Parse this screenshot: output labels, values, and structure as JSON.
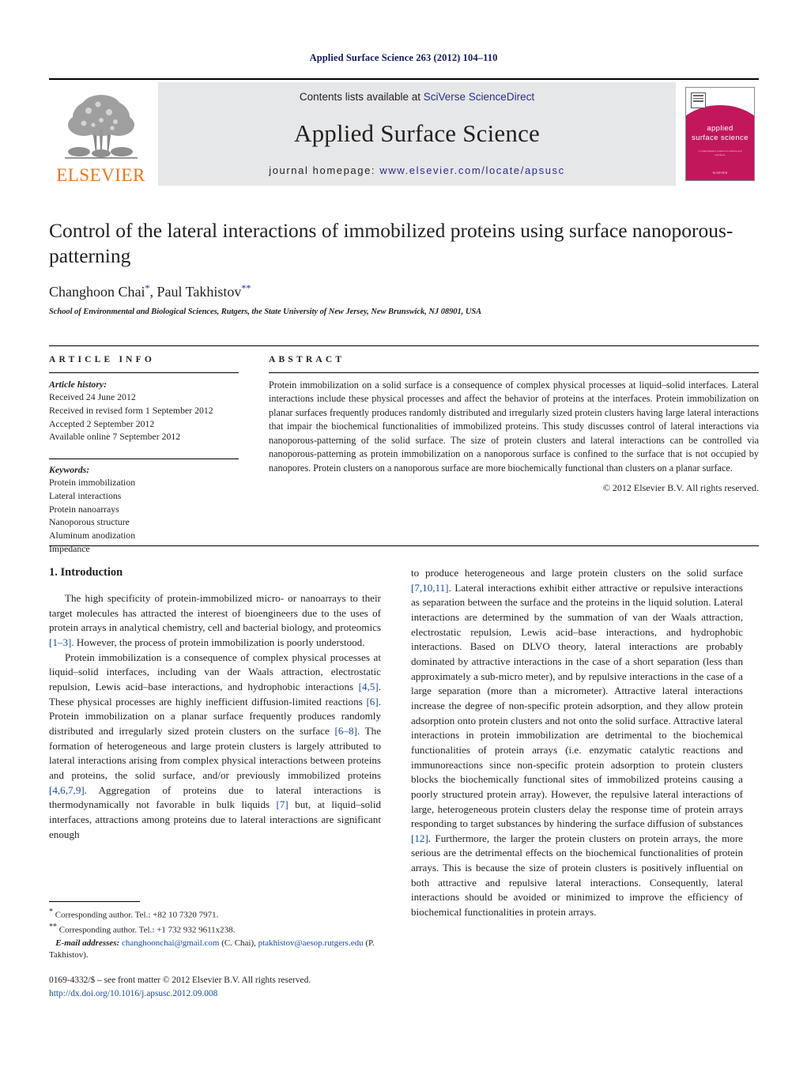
{
  "running_head": "Applied Surface Science 263 (2012) 104–110",
  "masthead": {
    "publisher_logo_text": "ELSEVIER",
    "contents_prefix": "Contents lists available at ",
    "contents_link": "SciVerse ScienceDirect",
    "journal_name": "Applied Surface Science",
    "homepage_prefix": "journal homepage: ",
    "homepage_url": "www.elsevier.com/locate/apsusc",
    "cover": {
      "title_line1": "applied",
      "title_line2": "surface science",
      "subtitle": "a comprehensive journal\non surfaces and interfaces",
      "footer": "ELSEVIER"
    },
    "band_bg": "#e6e7e8",
    "link_color": "#2b2b8f",
    "cover_color": "#c2175b",
    "elsevier_orange": "#e87722"
  },
  "title": "Control of the lateral interactions of immobilized proteins using surface nanoporous-patterning",
  "authors": {
    "author1": "Changhoon Chai",
    "author1_mark": "*",
    "separator": ", ",
    "author2": "Paul Takhistov",
    "author2_mark": "**"
  },
  "affiliation": "School of Environmental and Biological Sciences, Rutgers, the State University of New Jersey, New Brunswick, NJ 08901, USA",
  "article_info": {
    "heading": "ARTICLE INFO",
    "history_heading": "Article history:",
    "history": [
      "Received 24 June 2012",
      "Received in revised form 1 September 2012",
      "Accepted 2 September 2012",
      "Available online 7 September 2012"
    ],
    "keywords_heading": "Keywords:",
    "keywords": [
      "Protein immobilization",
      "Lateral interactions",
      "Protein nanoarrays",
      "Nanoporous structure",
      "Aluminum anodization",
      "Impedance"
    ]
  },
  "abstract": {
    "heading": "ABSTRACT",
    "text": "Protein immobilization on a solid surface is a consequence of complex physical processes at liquid–solid interfaces. Lateral interactions include these physical processes and affect the behavior of proteins at the interfaces. Protein immobilization on planar surfaces frequently produces randomly distributed and irregularly sized protein clusters having large lateral interactions that impair the biochemical functionalities of immobilized proteins. This study discusses control of lateral interactions via nanoporous-patterning of the solid surface. The size of protein clusters and lateral interactions can be controlled via nanoporous-patterning as protein immobilization on a nanoporous surface is confined to the surface that is not occupied by nanopores. Protein clusters on a nanoporous surface are more biochemically functional than clusters on a planar surface.",
    "copyright": "© 2012 Elsevier B.V. All rights reserved."
  },
  "body": {
    "section_title": "1.  Introduction",
    "left_paragraphs": [
      "The high specificity of protein-immobilized micro- or nanoarrays to their target molecules has attracted the interest of bioengineers due to the uses of protein arrays in analytical chemistry, cell and bacterial biology, and proteomics [1–3]. However, the process of protein immobilization is poorly understood.",
      "Protein immobilization is a consequence of complex physical processes at liquid–solid interfaces, including van der Waals attraction, electrostatic repulsion, Lewis acid–base interactions, and hydrophobic interactions [4,5]. These physical processes are highly inefficient diffusion-limited reactions [6]. Protein immobilization on a planar surface frequently produces randomly distributed and irregularly sized protein clusters on the surface [6–8]. The formation of heterogeneous and large protein clusters is largely attributed to lateral interactions arising from complex physical interactions between proteins and proteins, the solid surface, and/or previously immobilized proteins [4,6,7,9]. Aggregation of proteins due to lateral interactions is thermodynamically not favorable in bulk liquids [7] but, at liquid–solid interfaces, attractions among proteins due to lateral interactions are significant enough"
    ],
    "right_paragraphs": [
      "to produce heterogeneous and large protein clusters on the solid surface [7,10,11]. Lateral interactions exhibit either attractive or repulsive interactions as separation between the surface and the proteins in the liquid solution. Lateral interactions are determined by the summation of van der Waals attraction, electrostatic repulsion, Lewis acid–base interactions, and hydrophobic interactions. Based on DLVO theory, lateral interactions are probably dominated by attractive interactions in the case of a short separation (less than approximately a sub-micro meter), and by repulsive interactions in the case of a large separation (more than a micrometer). Attractive lateral interactions increase the degree of non-specific protein adsorption, and they allow protein adsorption onto protein clusters and not onto the solid surface. Attractive lateral interactions in protein immobilization are detrimental to the biochemical functionalities of protein arrays (i.e. enzymatic catalytic reactions and immunoreactions since non-specific protein adsorption to protein clusters blocks the biochemically functional sites of immobilized proteins causing a poorly structured protein array). However, the repulsive lateral interactions of large, heterogeneous protein clusters delay the response time of protein arrays responding to target substances by hindering the surface diffusion of substances [12]. Furthermore, the larger the protein clusters on protein arrays, the more serious are the detrimental effects on the biochemical functionalities of protein arrays. This is because the size of protein clusters is positively influential on both attractive and repulsive lateral interactions. Consequently, lateral interactions should be avoided or minimized to improve the efficiency of biochemical functionalities in protein arrays."
    ]
  },
  "footnotes": {
    "line1_mark": "*",
    "line1": "Corresponding author. Tel.: +82 10 7320 7971.",
    "line2_mark": "**",
    "line2": "Corresponding author. Tel.: +1 732 932 9611x238.",
    "email_label": "E-mail addresses:",
    "email1": "changhoonchai@gmail.com",
    "email1_who": "(C. Chai),",
    "email2": "ptakhistov@aesop.rutgers.edu",
    "email2_who": "(P. Takhistov)."
  },
  "imprint": {
    "issn_line": "0169-4332/$ – see front matter © 2012 Elsevier B.V. All rights reserved.",
    "doi_line": "http://dx.doi.org/10.1016/j.apsusc.2012.09.008"
  }
}
